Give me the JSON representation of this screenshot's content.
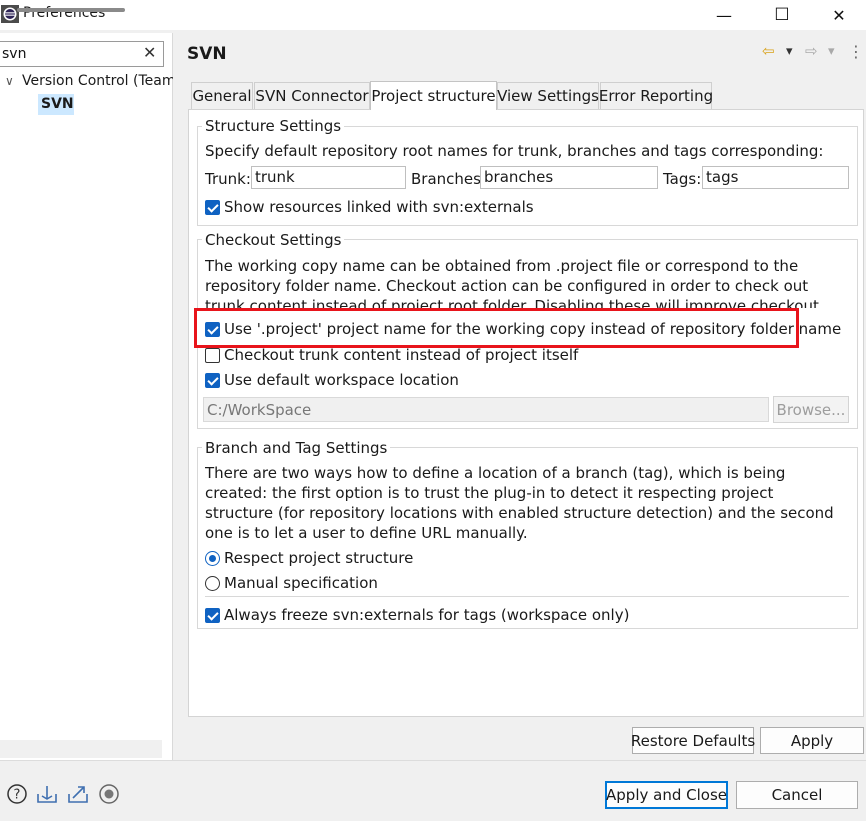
{
  "window": {
    "title": "Preferences",
    "minimize_glyph": "—",
    "maximize_glyph": "☐",
    "close_glyph": "✕"
  },
  "left": {
    "filter_value": "svn",
    "filter_clear": "✕",
    "tree_arrow": "∨",
    "tree": [
      {
        "label": "Version Control (Team)"
      },
      {
        "label": "SVN"
      }
    ]
  },
  "header": {
    "title": "SVN",
    "back_glyph": "⇦",
    "forward_glyph": "⇨",
    "dropdown_glyph": "▾",
    "menu_glyph": "⋮"
  },
  "tabs": [
    {
      "label": "General"
    },
    {
      "label": "SVN Connector"
    },
    {
      "label": "Project structure"
    },
    {
      "label": "View Settings"
    },
    {
      "label": "Error Reporting"
    }
  ],
  "structure": {
    "title": "Structure Settings",
    "description": "Specify default repository root names for trunk, branches and tags corresponding:",
    "trunk_label": "Trunk:",
    "trunk_value": "trunk",
    "branches_label": "Branches:",
    "branches_value": "branches",
    "tags_label": "Tags:",
    "tags_value": "tags",
    "externals_label": "Show resources linked with svn:externals"
  },
  "checkout": {
    "title": "Checkout Settings",
    "description": "The working copy name can be obtained from .project file or correspond to the repository folder name. Checkout action can be configured in order to check out trunk content instead of project root folder. Disabling these will improve checkout performance.",
    "use_project_name_label": "Use '.project' project name for the working copy instead of repository folder name",
    "trunk_content_label": "Checkout trunk content instead of project itself",
    "default_location_label": "Use default workspace location",
    "location_value": "C:/WorkSpace",
    "browse_label": "Browse..."
  },
  "branch": {
    "title": "Branch and Tag Settings",
    "description": "There are two ways how to define a location of a branch (tag), which is being created: the first option is to trust the plug-in to detect it respecting project structure (for repository locations with enabled structure detection) and the second one is to let a user to define URL manually.",
    "respect_label": "Respect project structure",
    "manual_label": "Manual specification",
    "freeze_label": "Always freeze svn:externals for tags (workspace only)"
  },
  "buttons": {
    "restore_defaults": "Restore Defaults",
    "apply": "Apply",
    "apply_and_close": "Apply and Close",
    "cancel": "Cancel"
  },
  "colors": {
    "accent": "#0f62c2",
    "highlight": "#e8141b",
    "selection": "#cce8ff"
  }
}
